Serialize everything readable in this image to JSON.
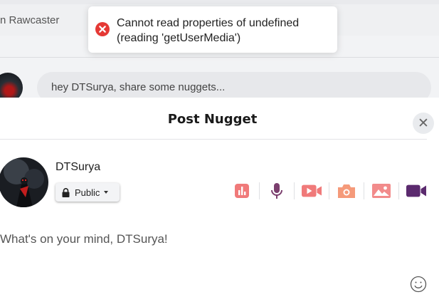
{
  "background": {
    "header_title": "n Rawcaster",
    "composer_placeholder": "hey DTSurya, share some nuggets..."
  },
  "toast": {
    "icon": "error-circle-icon",
    "message": "Cannot read properties of undefined (reading 'getUserMedia')",
    "color": "#e53935"
  },
  "modal": {
    "title": "Post Nugget",
    "close_icon": "close-icon",
    "user": {
      "name": "DTSurya"
    },
    "privacy": {
      "label": "Public",
      "icon": "lock-icon"
    },
    "tools": [
      {
        "name": "poll-icon",
        "color": "#f07a7a"
      },
      {
        "name": "microphone-icon",
        "color": "#7b3f6e"
      },
      {
        "name": "video-camera-icon",
        "color": "#f07a7a"
      },
      {
        "name": "camera-icon",
        "color": "#f59a7a"
      },
      {
        "name": "image-icon",
        "color": "#f28b8b"
      },
      {
        "name": "video-call-icon",
        "color": "#5b2a6e"
      }
    ],
    "compose_placeholder": "What's on your mind, DTSurya!",
    "emoji_icon": "smiley-icon"
  }
}
